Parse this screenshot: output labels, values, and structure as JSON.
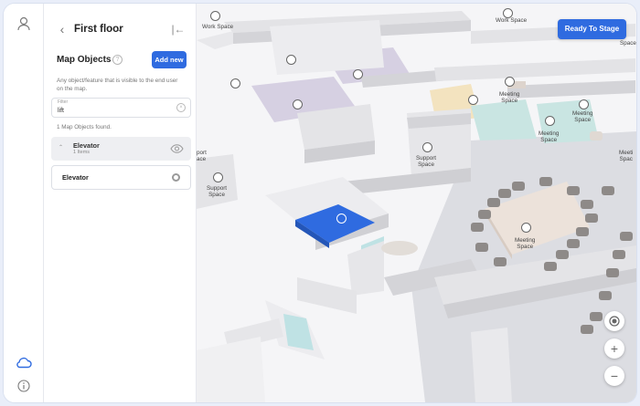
{
  "sidebar": {
    "floor": "First floor",
    "section_title": "Map Objects",
    "add_label": "Add new",
    "description": "Any object/feature that is visible to the end user on the map.",
    "filter": {
      "label": "Filter",
      "value": "lift"
    },
    "results": "1 Map Objects found.",
    "group": {
      "name": "Elevator",
      "count": "1 Items"
    },
    "items": [
      {
        "name": "Elevator"
      }
    ]
  },
  "toolbar": {
    "stage_label": "Ready To Stage"
  },
  "map": {
    "labels": {
      "work_space_left": "Work Space",
      "work_space_top": "Work Space",
      "space_right": "Space",
      "meeting_space_1": "Meeting\nSpace",
      "meeting_space_2": "Meeting\nSpace",
      "meeting_space_3": "Meeting\nSpace",
      "meeting_space_big": "Meeting\nSpace",
      "meeting_space_edge": "Meeti\nSpac",
      "support_space_center": "Support\nSpace",
      "support_space_left": "Support\nSpace",
      "support_space_edge": "port\nace"
    },
    "colors": {
      "selected": "#2f6be0",
      "wall": "#e2e2e5",
      "meeting_room": "#d8d0df",
      "glass": "#bfe2e4"
    }
  },
  "icons": {
    "user": "user-icon",
    "cloud": "cloud-icon",
    "info": "info-icon",
    "eye": "eye-icon"
  }
}
